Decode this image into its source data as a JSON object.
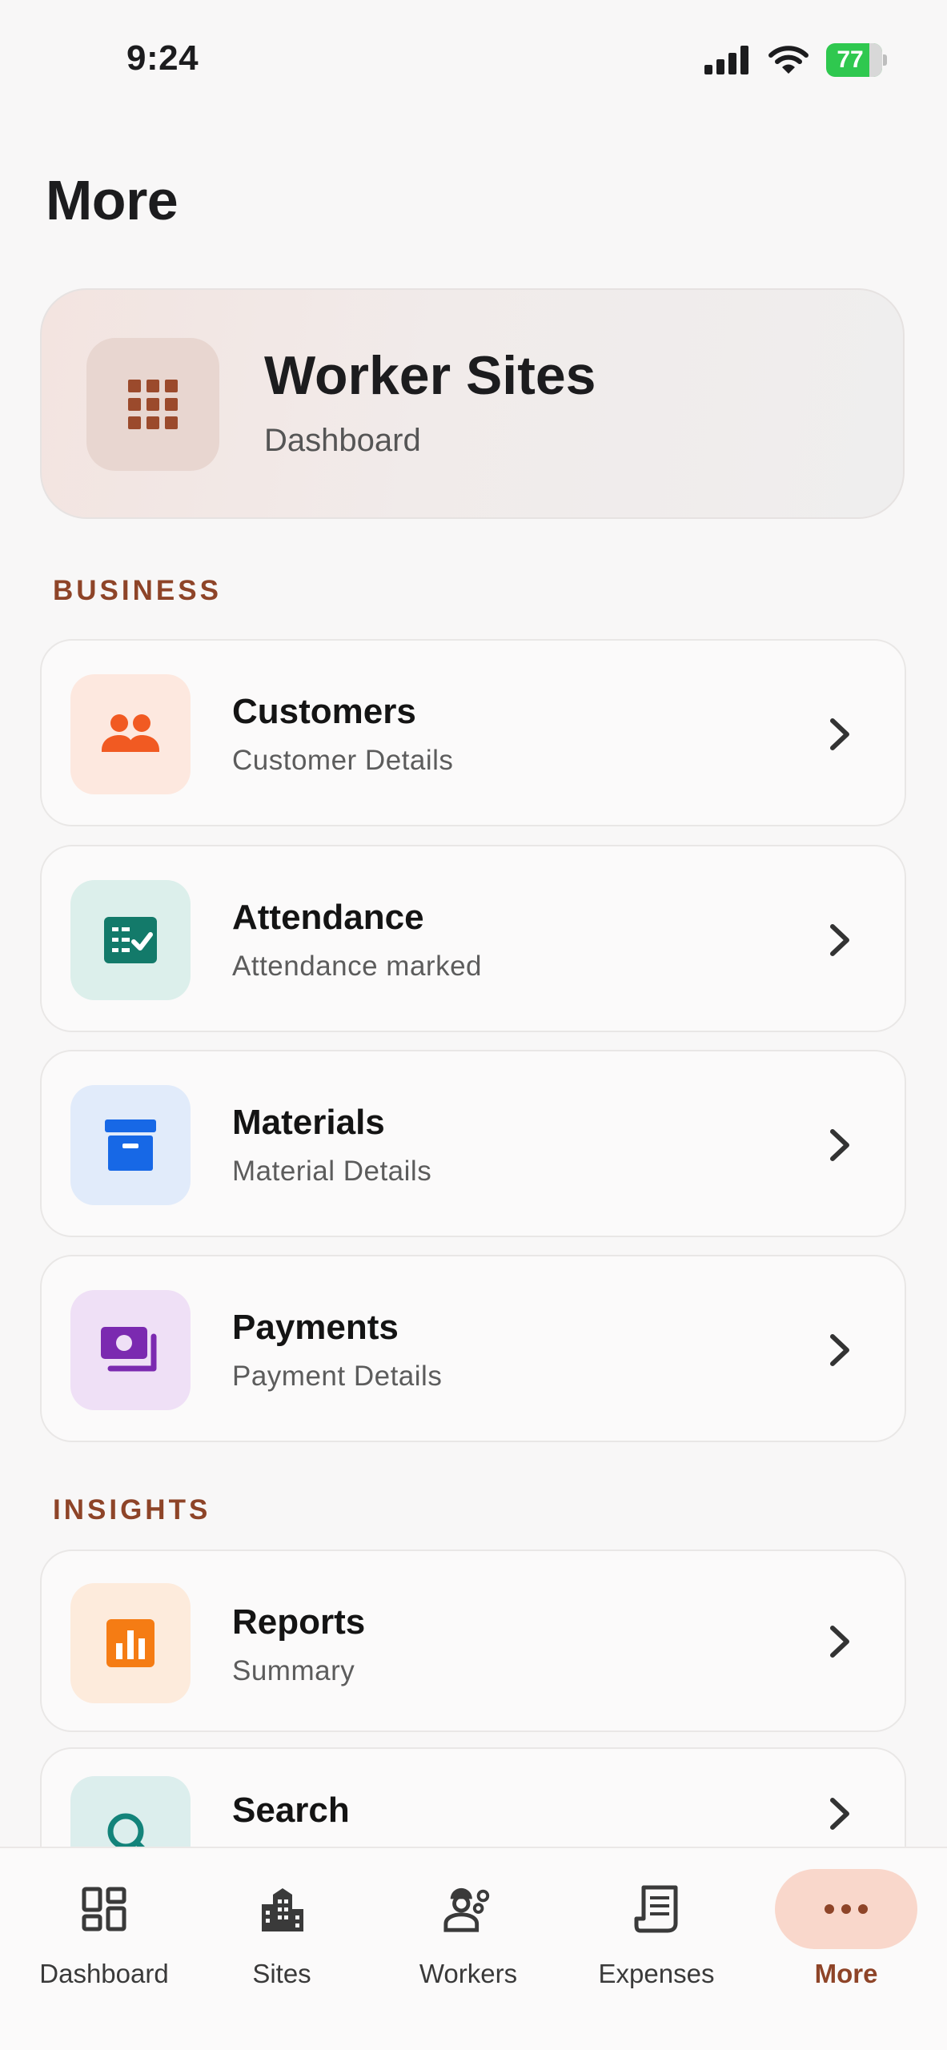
{
  "status_bar": {
    "time": "9:24",
    "battery_percent": "77",
    "battery_level": 0.77,
    "battery_color": "#2fc84f"
  },
  "page": {
    "title": "More"
  },
  "hero": {
    "title": "Worker Sites",
    "subtitle": "Dashboard",
    "icon": "grid-icon",
    "icon_color": "#9b4a2c"
  },
  "sections": {
    "business": {
      "label": "BUSINESS",
      "items": [
        {
          "title": "Customers",
          "subtitle": "Customer Details",
          "icon": "people-icon",
          "icon_color": "#f15a22",
          "icon_bg": "#fde8df"
        },
        {
          "title": "Attendance",
          "subtitle": "Attendance marked",
          "icon": "checklist-icon",
          "icon_color": "#137a6a",
          "icon_bg": "#dcefeb"
        },
        {
          "title": "Materials",
          "subtitle": "Material Details",
          "icon": "archive-box-icon",
          "icon_color": "#1768e6",
          "icon_bg": "#e1ebfa"
        },
        {
          "title": "Payments",
          "subtitle": "Payment Details",
          "icon": "money-icon",
          "icon_color": "#7b2ab0",
          "icon_bg": "#efe0f6"
        }
      ]
    },
    "insights": {
      "label": "INSIGHTS",
      "items": [
        {
          "title": "Reports",
          "subtitle": "Summary",
          "icon": "bar-chart-icon",
          "icon_color": "#f57c14",
          "icon_bg": "#fdebdc"
        },
        {
          "title": "Search",
          "subtitle": "",
          "icon": "search-icon",
          "icon_color": "#13837a",
          "icon_bg": "#dceeed"
        }
      ]
    }
  },
  "bottom_nav": {
    "items": [
      {
        "label": "Dashboard",
        "icon": "dashboard-icon"
      },
      {
        "label": "Sites",
        "icon": "buildings-icon"
      },
      {
        "label": "Workers",
        "icon": "workers-icon"
      },
      {
        "label": "Expenses",
        "icon": "receipt-icon"
      },
      {
        "label": "More",
        "icon": "more-dots-icon",
        "active": true
      }
    ],
    "active_color": "#8e4428",
    "active_bg": "#f9d7cb"
  }
}
